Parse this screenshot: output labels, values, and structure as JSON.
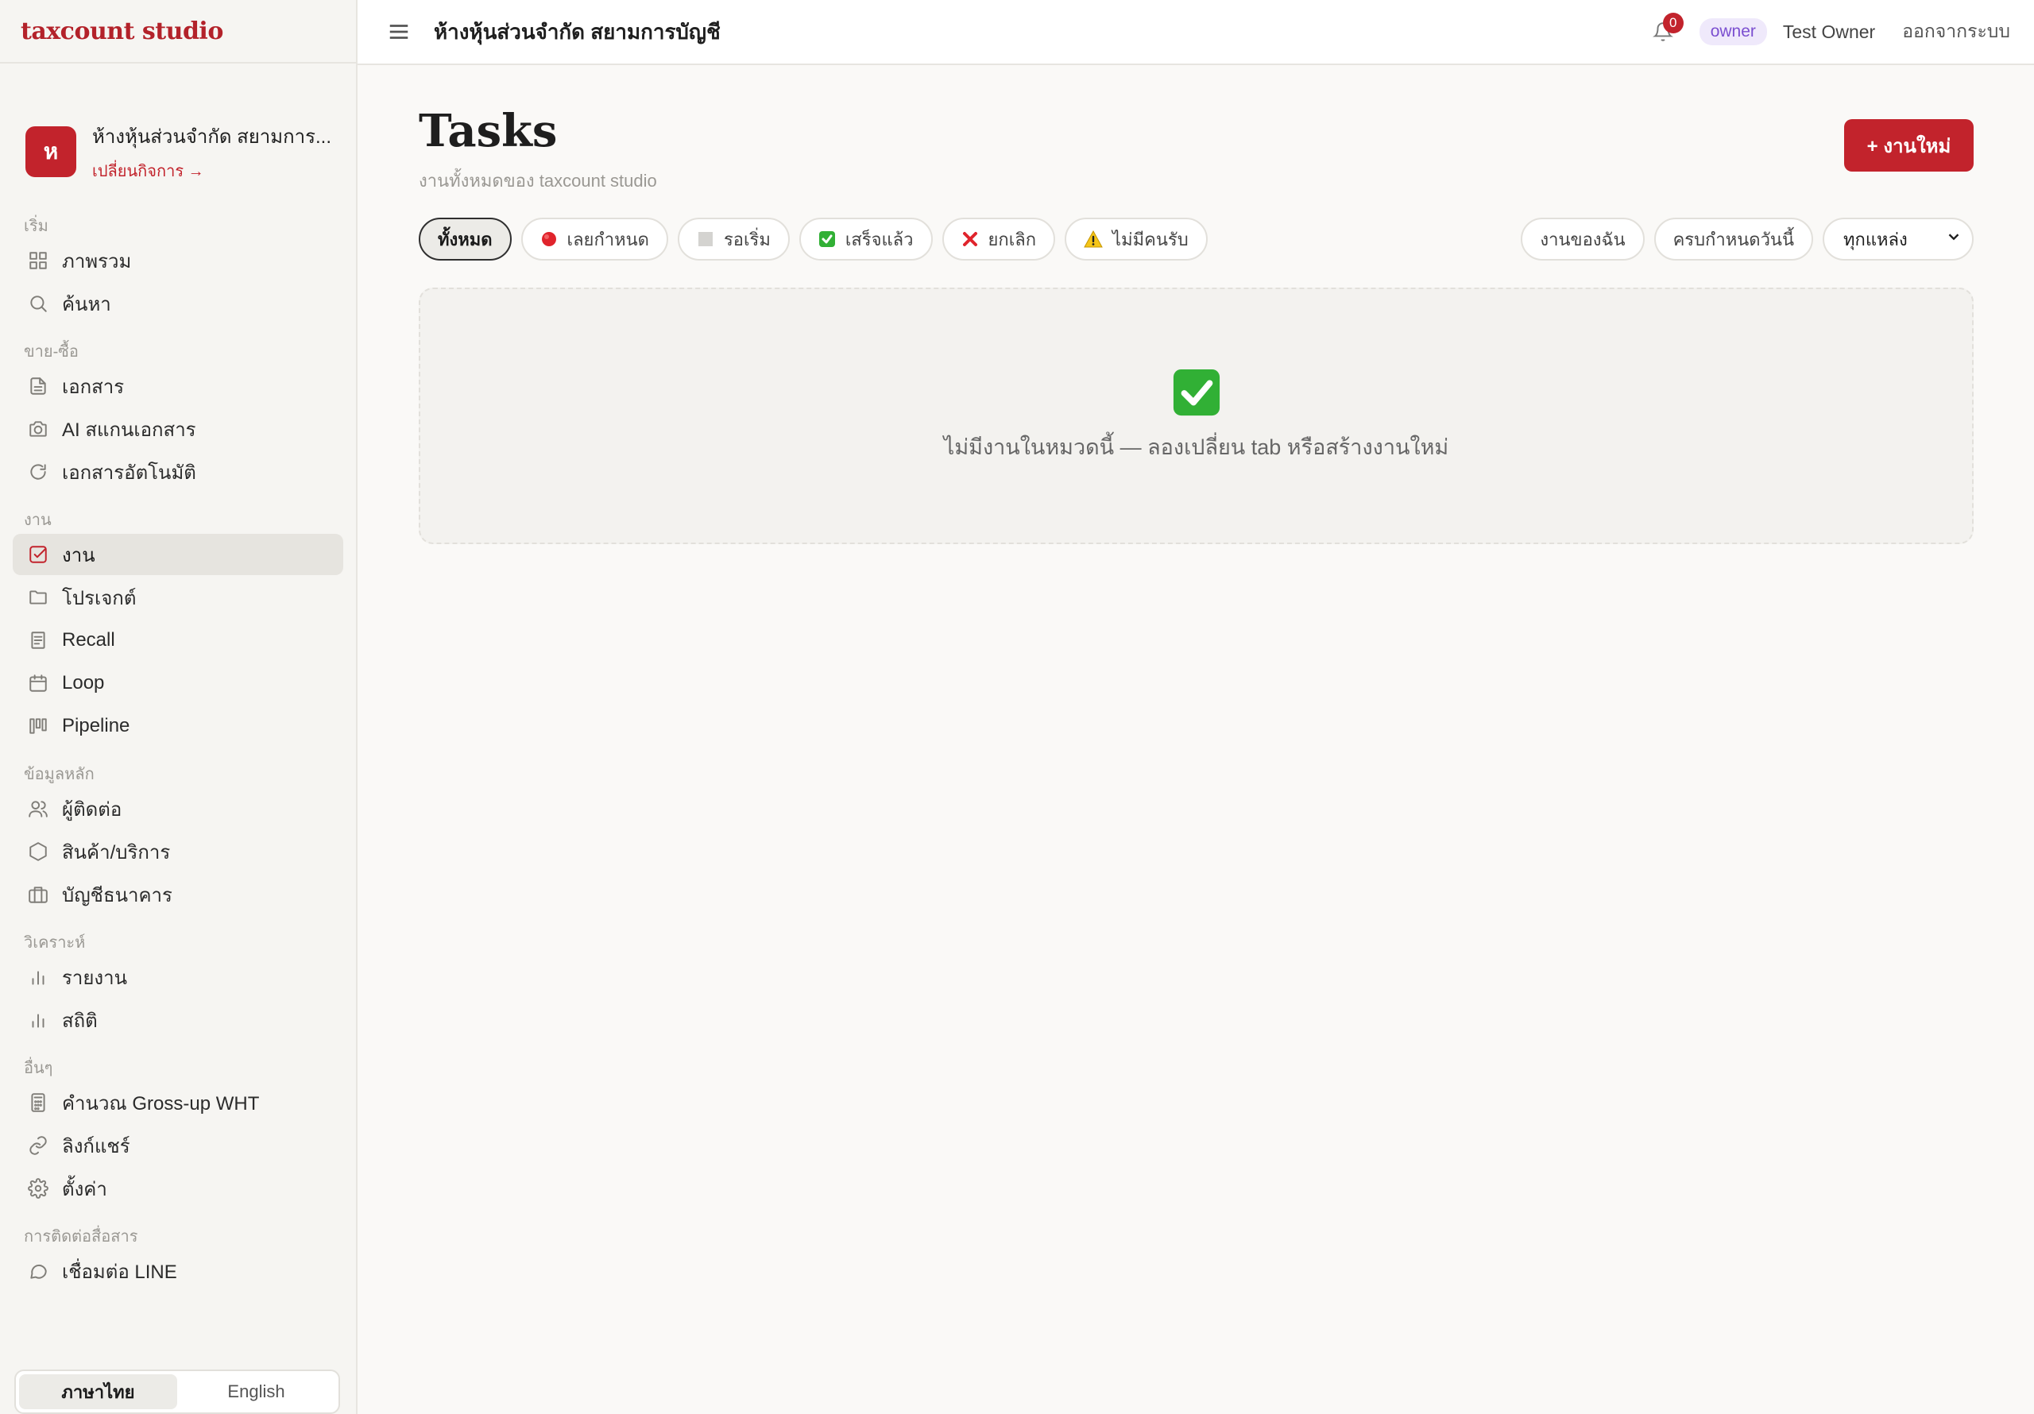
{
  "brand": "taxcount studio",
  "workspace": {
    "avatar": "ห",
    "name": "ห้างหุ้นส่วนจำกัด สยามการ...",
    "switch_label": "เปลี่ยนกิจการ →"
  },
  "sidebar": {
    "sections": [
      {
        "label": "เริ่ม",
        "items": [
          {
            "label": "ภาพรวม",
            "icon": "grid-icon"
          },
          {
            "label": "ค้นหา",
            "icon": "search-icon"
          }
        ]
      },
      {
        "label": "ขาย-ซื้อ",
        "items": [
          {
            "label": "เอกสาร",
            "icon": "document-icon"
          },
          {
            "label": "AI สแกนเอกสาร",
            "icon": "camera-icon"
          },
          {
            "label": "เอกสารอัตโนมัติ",
            "icon": "refresh-icon"
          }
        ]
      },
      {
        "label": "งาน",
        "items": [
          {
            "label": "งาน",
            "icon": "check-square-icon",
            "active": true
          },
          {
            "label": "โปรเจกต์",
            "icon": "folder-icon"
          },
          {
            "label": "Recall",
            "icon": "receipt-icon"
          },
          {
            "label": "Loop",
            "icon": "calendar-icon"
          },
          {
            "label": "Pipeline",
            "icon": "kanban-icon"
          }
        ]
      },
      {
        "label": "ข้อมูลหลัก",
        "items": [
          {
            "label": "ผู้ติดต่อ",
            "icon": "users-icon"
          },
          {
            "label": "สินค้า/บริการ",
            "icon": "hexagon-icon"
          },
          {
            "label": "บัญชีธนาคาร",
            "icon": "briefcase-icon"
          }
        ]
      },
      {
        "label": "วิเคราะห์",
        "items": [
          {
            "label": "รายงาน",
            "icon": "bar-chart-icon"
          },
          {
            "label": "สถิติ",
            "icon": "bar-chart-icon"
          }
        ]
      },
      {
        "label": "อื่นๆ",
        "items": [
          {
            "label": "คำนวณ Gross-up WHT",
            "icon": "calculator-icon"
          },
          {
            "label": "ลิงก์แชร์",
            "icon": "link-icon"
          },
          {
            "label": "ตั้งค่า",
            "icon": "gear-icon"
          }
        ]
      },
      {
        "label": "การติดต่อสื่อสาร",
        "items": [
          {
            "label": "เชื่อมต่อ LINE",
            "icon": "chat-icon"
          }
        ]
      }
    ]
  },
  "lang": {
    "thai": "ภาษาไทย",
    "english": "English"
  },
  "topbar": {
    "company": "ห้างหุ้นส่วนจำกัด สยามการบัญชี",
    "notifications": "0",
    "role": "owner",
    "user": "Test Owner",
    "logout": "ออกจากระบบ"
  },
  "page": {
    "title": "Tasks",
    "subtitle": "งานทั้งหมดของ taxcount studio",
    "new_button": "+ งานใหม่"
  },
  "filters": {
    "tabs": [
      {
        "label": "ทั้งหมด",
        "active": true
      },
      {
        "label": "เลยกำหนด",
        "icon": "red-circle-icon"
      },
      {
        "label": "รอเริ่ม",
        "icon": "gray-square-icon"
      },
      {
        "label": "เสร็จแล้ว",
        "icon": "green-check-icon"
      },
      {
        "label": "ยกเลิก",
        "icon": "red-x-icon"
      },
      {
        "label": "ไม่มีคนรับ",
        "icon": "warning-icon"
      }
    ],
    "my_tasks": "งานของฉัน",
    "due_today": "ครบกำหนดวันนี้",
    "source_select": "ทุกแหล่ง"
  },
  "empty": {
    "text": "ไม่มีงานในหมวดนี้ — ลองเปลี่ยน tab หรือสร้างงานใหม่"
  },
  "colors": {
    "accent": "#c2232c",
    "role_badge": "#7b4fd0"
  }
}
